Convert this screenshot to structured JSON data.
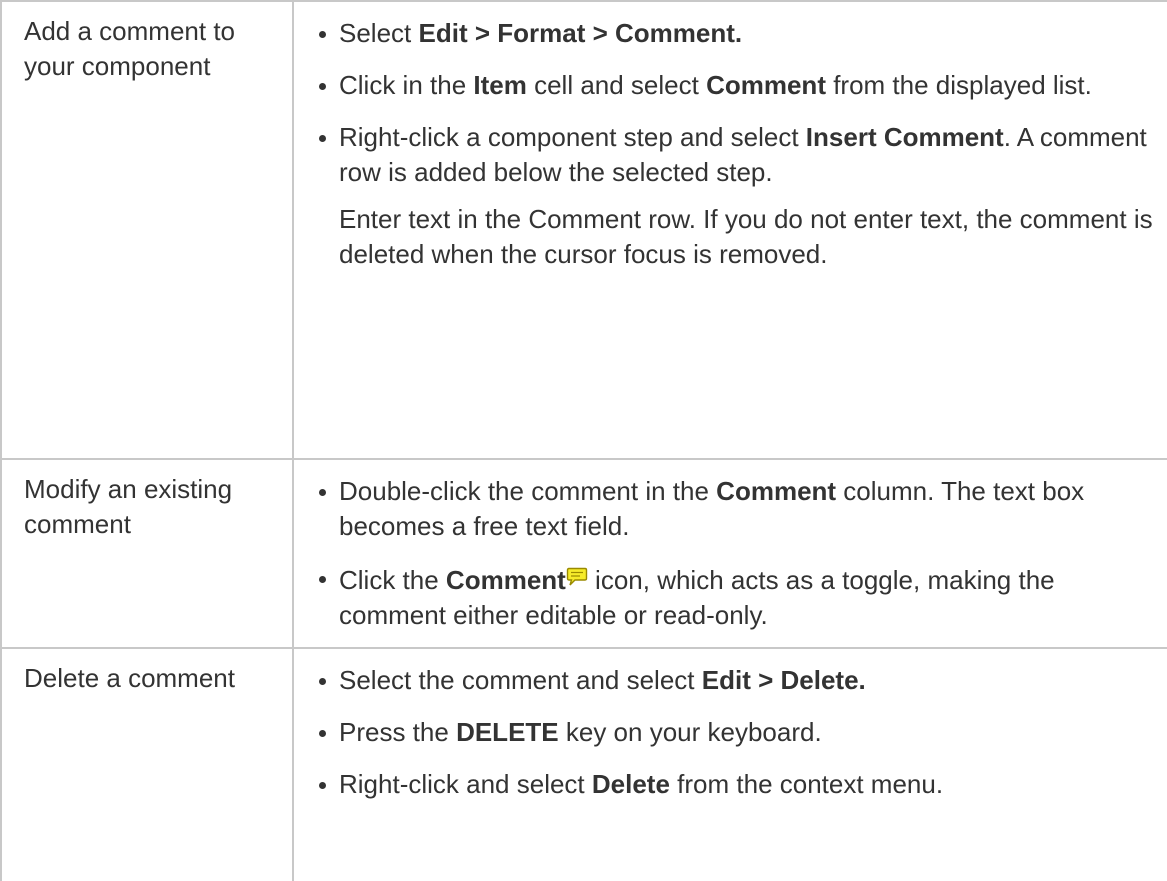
{
  "rows": [
    {
      "task": "Add a comment to your component",
      "steps": [
        {
          "parts": [
            [
              "Select ",
              false
            ],
            [
              "Edit > Format > Comment.",
              true
            ]
          ]
        },
        {
          "parts": [
            [
              "Click in the ",
              false
            ],
            [
              "Item",
              true
            ],
            [
              " cell and select ",
              false
            ],
            [
              "Comment",
              true
            ],
            [
              " from the displayed list.",
              false
            ]
          ]
        },
        {
          "parts": [
            [
              "Right-click a component step and select ",
              false
            ],
            [
              "Insert Comment",
              true
            ],
            [
              ". A comment row is added below the selected step.",
              false
            ]
          ]
        }
      ],
      "note": "Enter text in the Comment row. If you do not enter text, the comment is deleted when the cursor focus is removed."
    },
    {
      "task": "Modify an existing comment",
      "steps": [
        {
          "parts": [
            [
              "Double-click the comment in the ",
              false
            ],
            [
              "Comment",
              true
            ],
            [
              " column. The text box becomes a free text field.",
              false
            ]
          ]
        },
        {
          "parts": [
            [
              "Click the ",
              false
            ],
            [
              "Comment",
              true
            ],
            [
              "ICON",
              false
            ],
            [
              " icon, which acts as a toggle, making the comment either editable or read-only.",
              false
            ]
          ]
        }
      ]
    },
    {
      "task": "Delete a comment",
      "steps": [
        {
          "parts": [
            [
              "Select the comment and select ",
              false
            ],
            [
              "Edit > Delete.",
              true
            ]
          ]
        },
        {
          "parts": [
            [
              "Press the ",
              false
            ],
            [
              "DELETE",
              true
            ],
            [
              " key on your keyboard.",
              false
            ]
          ]
        },
        {
          "parts": [
            [
              "Right-click and select ",
              false
            ],
            [
              "Delete",
              true
            ],
            [
              " from the context menu.",
              false
            ]
          ]
        }
      ]
    }
  ],
  "icons": {
    "comment_icon": "comment-icon",
    "comment_icon_fill": "#f6ec2a",
    "comment_icon_stroke": "#9a8a00"
  },
  "colors": {
    "text": "#333333",
    "border": "#c8c8c8"
  }
}
